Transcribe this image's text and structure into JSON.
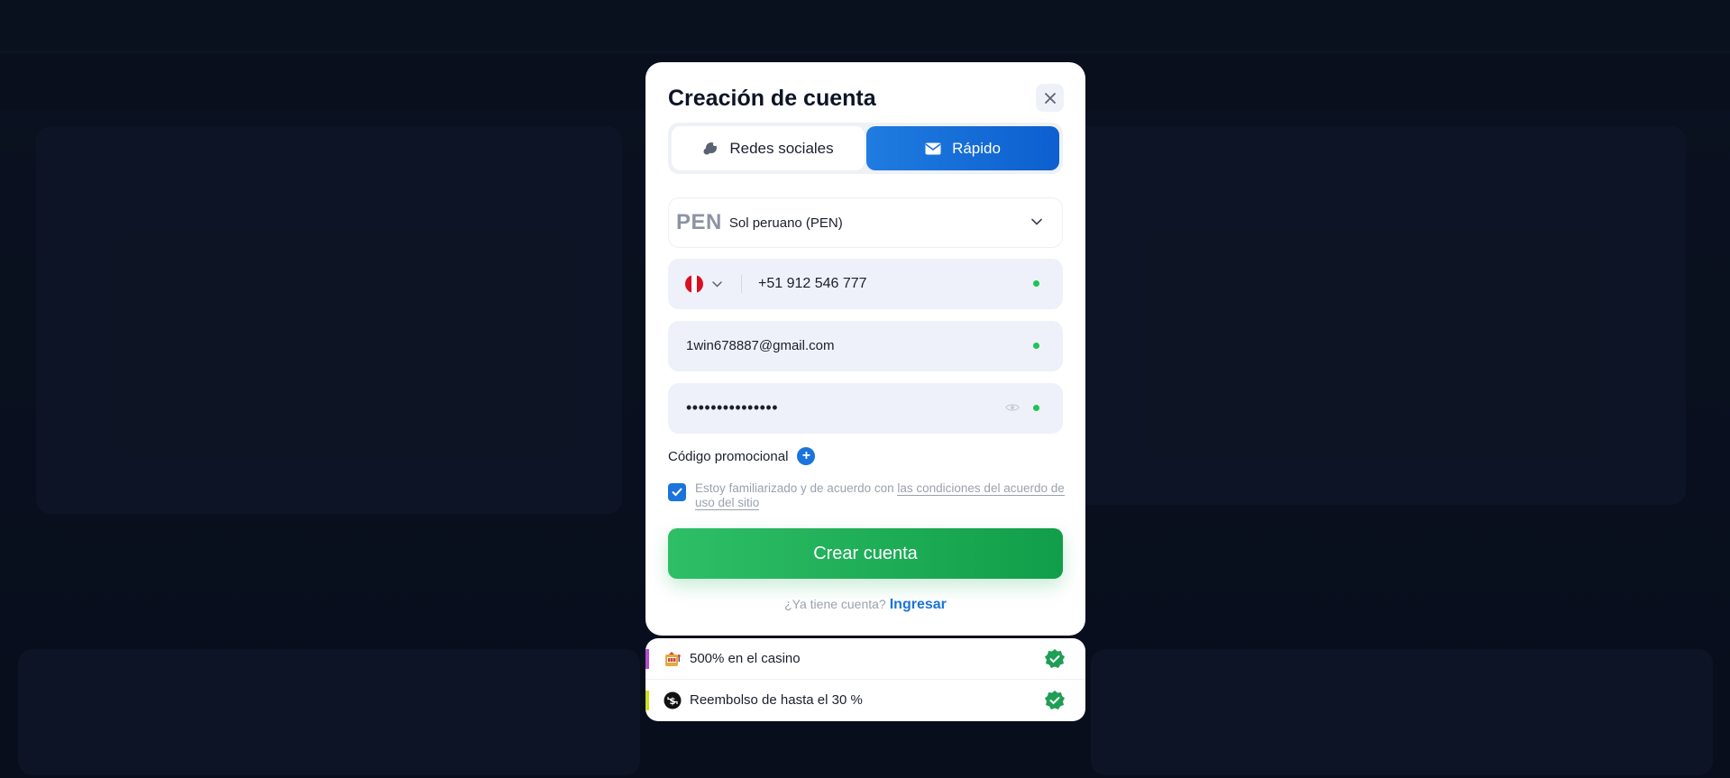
{
  "modal": {
    "title": "Creación de cuenta",
    "tabs": [
      {
        "label": "Redes sociales",
        "icon": "chat-bubble-icon",
        "active": false
      },
      {
        "label": "Rápido",
        "icon": "envelope-icon",
        "active": true
      }
    ],
    "currency": {
      "code": "PEN",
      "name": "Sol peruano (PEN)"
    },
    "phone": {
      "country_flag": "peru-flag-icon",
      "value": "+51 912 546 777"
    },
    "email": {
      "value": "1win678887@gmail.com"
    },
    "password": {
      "masked_value": "•••••••••••••••"
    },
    "promo_label": "Código promocional",
    "terms": {
      "text": "Estoy familiarizado y de acuerdo con ",
      "link": "las condiciones del acuerdo de uso del sitio",
      "checked": true
    },
    "submit_label": "Crear cuenta",
    "login_prompt": "¿Ya tiene cuenta?",
    "login_link": "Ingresar"
  },
  "bonuses": [
    {
      "label": "500% en el casino",
      "icon": "slot-machine-icon",
      "accent": "#b44ad6"
    },
    {
      "label": "Reembolso de hasta el 30 %",
      "icon": "cashback-icon",
      "accent": "#c8e020"
    }
  ],
  "colors": {
    "primary": "#1a74db",
    "success": "#1ec455",
    "overlay": "#0c1526"
  }
}
